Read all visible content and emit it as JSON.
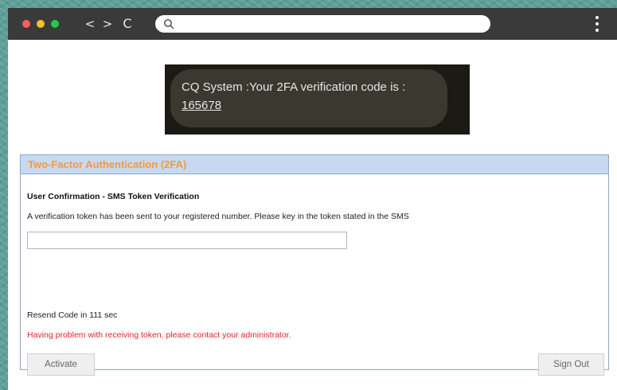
{
  "browser": {
    "nav": {
      "back": "<",
      "forward": ">",
      "reload": "C"
    },
    "address": {
      "value": "",
      "placeholder": ""
    },
    "icons": [
      "search-icon",
      "kebab-menu-icon",
      "back-arrow-icon",
      "forward-arrow-icon",
      "reload-icon"
    ],
    "traffic_light_colors": [
      "#ff5f57",
      "#febc2e",
      "#28c840"
    ]
  },
  "sms": {
    "message": "CQ System :Your 2FA verification code is :",
    "code": "165678"
  },
  "tfa": {
    "title": "Two-Factor Authentication (2FA)",
    "subtitle": "User Confirmation - SMS Token Verification",
    "instructions": "A verification token has been sent to your registered number. Please key in the token stated in the SMS",
    "token_input": {
      "value": "",
      "placeholder": ""
    },
    "resend": "Resend Code in 111 sec",
    "problem": "Having problem with receiving token. please contact your administrator.",
    "activate_label": "Activate",
    "signout_label": "Sign Out",
    "colors": {
      "title": "#f39a3c",
      "header_bg": "#c7d9f0",
      "error": "#e0242b"
    }
  }
}
